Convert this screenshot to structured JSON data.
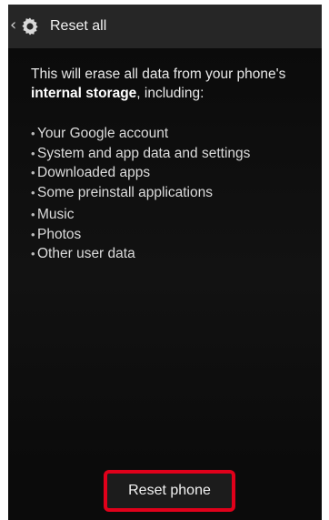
{
  "header": {
    "title": "Reset all",
    "back_icon": "back-caret-icon",
    "app_icon": "gear-icon"
  },
  "message": {
    "prefix": "This will erase all data from your phone's ",
    "emphasis": "internal storage",
    "suffix": ", including:"
  },
  "items": [
    "Your Google account",
    "System and app data and settings",
    "Downloaded apps",
    "Some preinstall applications",
    "Music",
    "Photos",
    "Other user data"
  ],
  "footer": {
    "reset_label": "Reset phone",
    "highlight_color": "#e0001a"
  }
}
